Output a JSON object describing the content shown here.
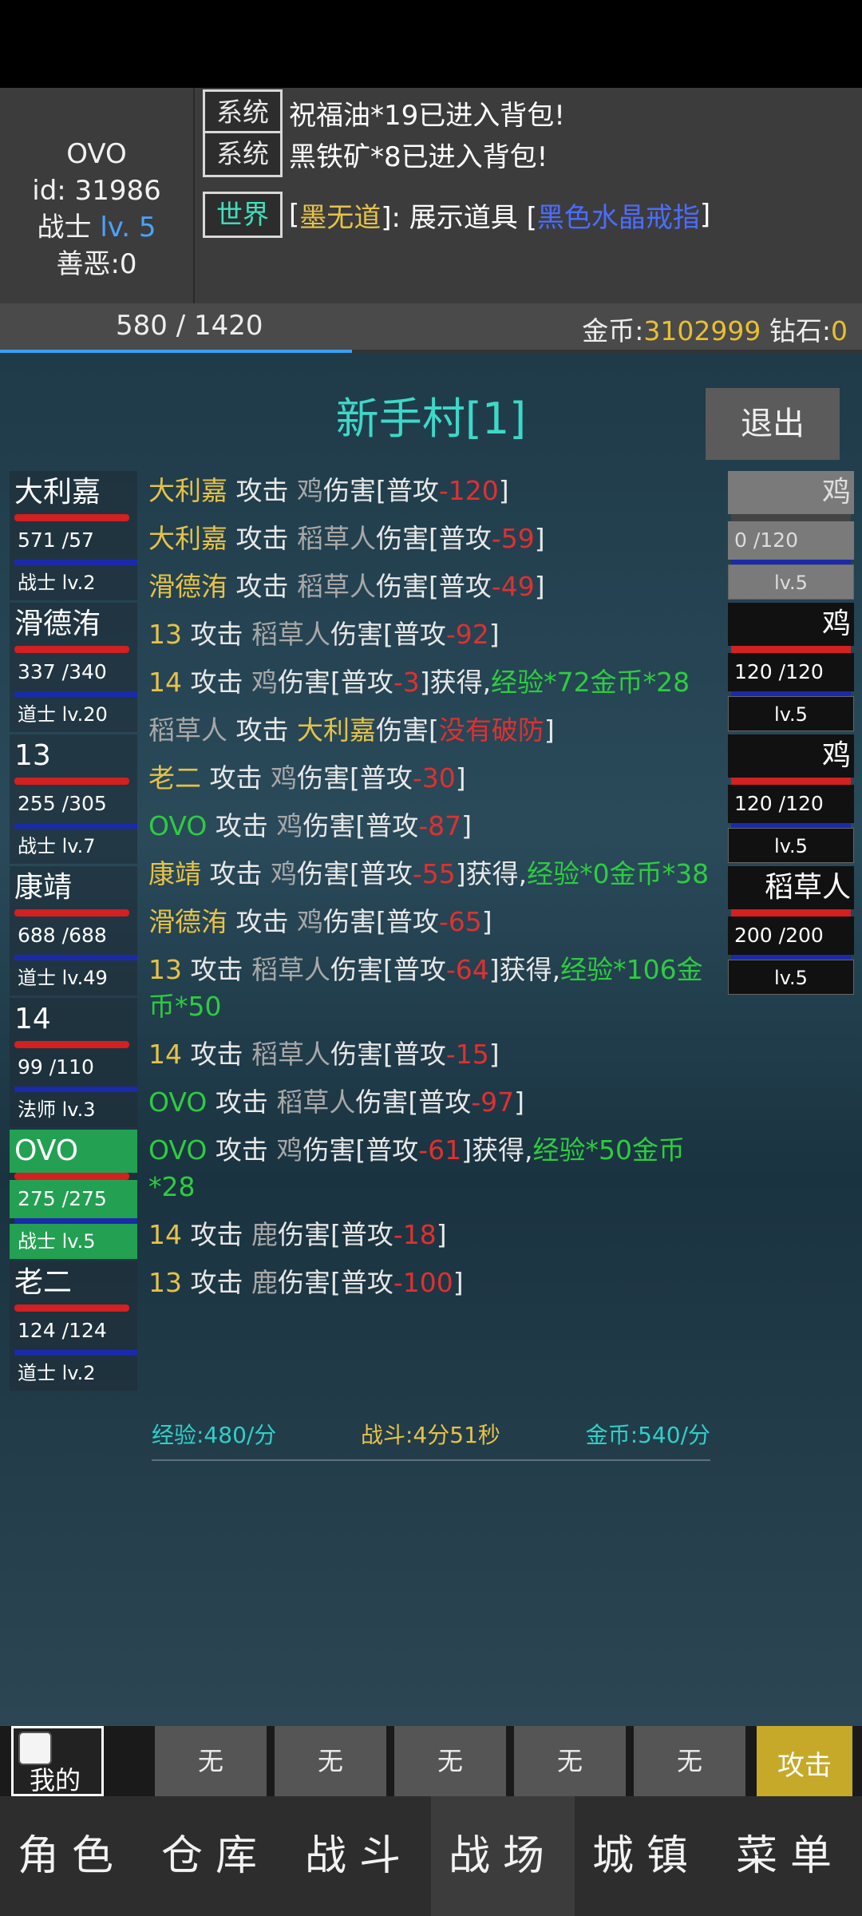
{
  "player": {
    "name": "OVO",
    "id_line": "id: 31986",
    "class": "战士",
    "level": "lv. 5",
    "karma": "善恶:0"
  },
  "chat": [
    {
      "tag": "系统",
      "text": "祝福油*19已进入背包!"
    },
    {
      "tag": "系统",
      "text": "黑铁矿*8已进入背包!"
    },
    {
      "tag": "世界",
      "pre": "[",
      "name": "墨无道",
      "mid": "]: 展示道具 [",
      "item": "黑色水晶戒指",
      "post": "]"
    }
  ],
  "resources": {
    "xp": "580 / 1420",
    "xp_fraction": 0.408,
    "gold_label": "金币:",
    "gold": "3102999",
    "diamond_label": "钻石:",
    "diamond": "0"
  },
  "location": "新手村[1]",
  "exit_label": "退出",
  "party": [
    {
      "name": "大利嘉",
      "hp": "571 /57",
      "cls": "战士 lv.2"
    },
    {
      "name": "滑德洧",
      "hp": "337 /340",
      "cls": "道士 lv.20"
    },
    {
      "name": "13",
      "hp": "255 /305",
      "cls": "战士 lv.7"
    },
    {
      "name": "康靖",
      "hp": "688 /688",
      "cls": "道士 lv.49"
    },
    {
      "name": "14",
      "hp": "99 /110",
      "cls": "法师 lv.3"
    },
    {
      "name": "OVO",
      "hp": "275 /275",
      "cls": "战士 lv.5"
    },
    {
      "name": "老二",
      "hp": "124 /124",
      "cls": "道士 lv.2"
    }
  ],
  "enemies": [
    {
      "name": "鸡",
      "hp": "0 /120",
      "lv": "lv.5"
    },
    {
      "name": "鸡",
      "hp": "120 /120",
      "lv": "lv.5"
    },
    {
      "name": "鸡",
      "hp": "120 /120",
      "lv": "lv.5"
    },
    {
      "name": "稻草人",
      "hp": "200 /200",
      "lv": "lv.5"
    }
  ],
  "log": [
    {
      "a": "大利嘉",
      "verb": " 攻击 ",
      "t": "鸡",
      "d": "伤害[普攻",
      "v": "-120",
      "e": "]",
      "reward": ""
    },
    {
      "a": "大利嘉",
      "verb": " 攻击 ",
      "t": "稻草人",
      "d": "伤害[普攻",
      "v": "-59",
      "e": "]",
      "reward": ""
    },
    {
      "a": "滑德洧",
      "verb": " 攻击 ",
      "t": "稻草人",
      "d": "伤害[普攻",
      "v": "-49",
      "e": "]",
      "reward": ""
    },
    {
      "a": "13",
      "verb": " 攻击 ",
      "t": "稻草人",
      "d": "伤害[普攻",
      "v": "-92",
      "e": "]",
      "reward": ""
    },
    {
      "a": "14",
      "verb": " 攻击 ",
      "t": "鸡",
      "d": "伤害[普攻",
      "v": "-3",
      "e": "]获得,",
      "reward": "经验*72金币*28"
    },
    {
      "a": "稻草人",
      "verb": " 攻击 ",
      "t": "大利嘉",
      "d": "伤害[",
      "v": "没有破防",
      "e": "]",
      "reward": ""
    },
    {
      "a": "老二",
      "verb": " 攻击 ",
      "t": "鸡",
      "d": "伤害[普攻",
      "v": "-30",
      "e": "]",
      "reward": ""
    },
    {
      "a": "OVO",
      "verb": " 攻击 ",
      "t": "鸡",
      "d": "伤害[普攻",
      "v": "-87",
      "e": "]",
      "reward": ""
    },
    {
      "a": "康靖",
      "verb": " 攻击 ",
      "t": "鸡",
      "d": "伤害[普攻",
      "v": "-55",
      "e": "]获得,",
      "reward": "经验*0金币*38"
    },
    {
      "a": "滑德洧",
      "verb": " 攻击 ",
      "t": "鸡",
      "d": "伤害[普攻",
      "v": "-65",
      "e": "]",
      "reward": ""
    },
    {
      "a": "13",
      "verb": " 攻击 ",
      "t": "稻草人",
      "d": "伤害[普攻",
      "v": "-64",
      "e": "]获得,",
      "reward": "经验*106金币*50"
    },
    {
      "a": "14",
      "verb": " 攻击 ",
      "t": "稻草人",
      "d": "伤害[普攻",
      "v": "-15",
      "e": "]",
      "reward": ""
    },
    {
      "a": "OVO",
      "verb": " 攻击 ",
      "t": "稻草人",
      "d": "伤害[普攻",
      "v": "-97",
      "e": "]",
      "reward": ""
    },
    {
      "a": "OVO",
      "verb": " 攻击 ",
      "t": "鸡",
      "d": "伤害[普攻",
      "v": "-61",
      "e": "]获得,",
      "reward": "经验*50金币*28"
    },
    {
      "a": "14",
      "verb": " 攻击 ",
      "t": "鹿",
      "d": "伤害[普攻",
      "v": "-18",
      "e": "]",
      "reward": ""
    },
    {
      "a": "13",
      "verb": " 攻击 ",
      "t": "鹿",
      "d": "伤害[普攻",
      "v": "-100",
      "e": "]",
      "reward": ""
    }
  ],
  "stats": {
    "xp_rate": "经验:480/分",
    "fight_time": "战斗:4分51秒",
    "gold_rate": "金币:540/分"
  },
  "skills": {
    "my_label": "我的",
    "slots": [
      "无",
      "无",
      "无",
      "无",
      "无"
    ],
    "attack": "攻击"
  },
  "nav": [
    "角色",
    "仓库",
    "战斗",
    "战场",
    "城镇",
    "菜单"
  ],
  "colors": {
    "accent": "#3ed8c8",
    "gold": "#e8c030",
    "hp": "#d32020",
    "mp": "#1a2aaa",
    "self": "#23a052"
  }
}
